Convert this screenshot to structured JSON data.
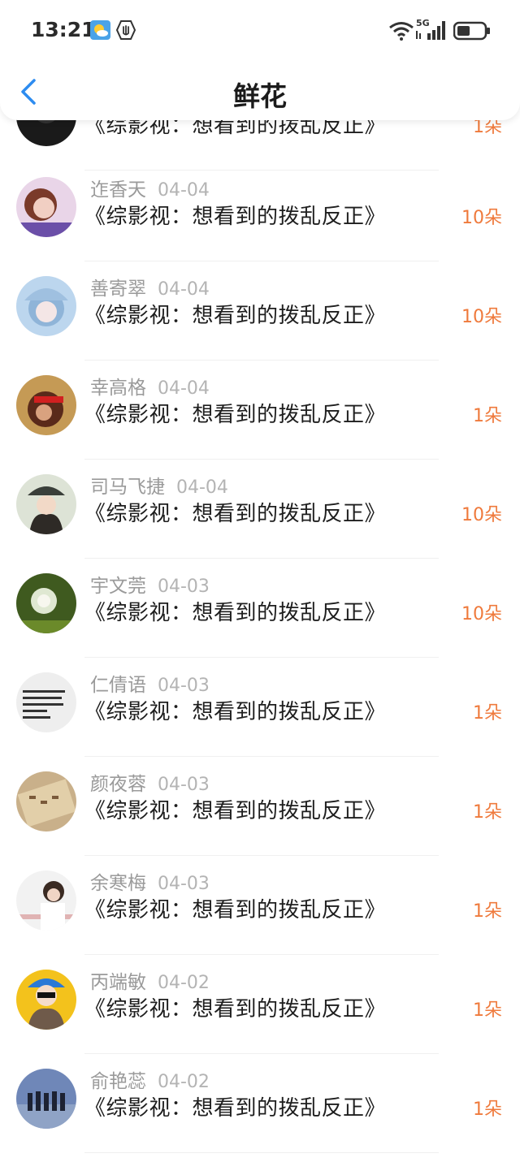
{
  "status_bar": {
    "time": "13:21",
    "network_label": "5G",
    "icons": [
      "weather-icon",
      "hand-icon",
      "wifi-icon",
      "signal-icon",
      "battery-icon"
    ]
  },
  "header": {
    "title": "鲜花",
    "back_icon": "chevron-left-icon"
  },
  "colors": {
    "accent_back": "#2d8cf0",
    "count": "#ef7a3c"
  },
  "partial_row": {
    "title": "《综影视：想看到的拨乱反正》",
    "count": "1朵"
  },
  "rows": [
    {
      "name": "迮香天",
      "date": "04-04",
      "title": "《综影视：想看到的拨乱反正》",
      "count": "10朵"
    },
    {
      "name": "善寄翠",
      "date": "04-04",
      "title": "《综影视：想看到的拨乱反正》",
      "count": "10朵"
    },
    {
      "name": "幸高格",
      "date": "04-04",
      "title": "《综影视：想看到的拨乱反正》",
      "count": "1朵"
    },
    {
      "name": "司马飞捷",
      "date": "04-04",
      "title": "《综影视：想看到的拨乱反正》",
      "count": "10朵"
    },
    {
      "name": "宇文莞",
      "date": "04-03",
      "title": "《综影视：想看到的拨乱反正》",
      "count": "10朵"
    },
    {
      "name": "仁倩语",
      "date": "04-03",
      "title": "《综影视：想看到的拨乱反正》",
      "count": "1朵"
    },
    {
      "name": "颜夜蓉",
      "date": "04-03",
      "title": "《综影视：想看到的拨乱反正》",
      "count": "1朵"
    },
    {
      "name": "余寒梅",
      "date": "04-03",
      "title": "《综影视：想看到的拨乱反正》",
      "count": "1朵"
    },
    {
      "name": "丙端敏",
      "date": "04-02",
      "title": "《综影视：想看到的拨乱反正》",
      "count": "1朵"
    },
    {
      "name": "俞艳蕊",
      "date": "04-02",
      "title": "《综影视：想看到的拨乱反正》",
      "count": "1朵"
    }
  ]
}
